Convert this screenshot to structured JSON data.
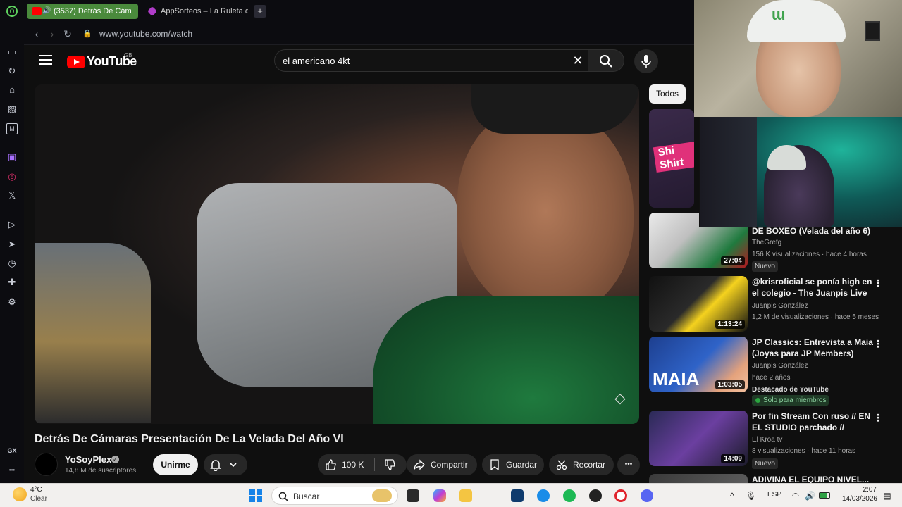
{
  "browser": {
    "tabs": [
      {
        "label": "(3537) Detrás De Cám",
        "active": true
      },
      {
        "label": "AppSorteos – La Ruleta de",
        "active": false
      }
    ],
    "new_tab_label": "+",
    "url": "www.youtube.com/watch",
    "sidebar_footer_label": "GX",
    "sidebar_more_label": "•••"
  },
  "youtube": {
    "wordmark": "YouTube",
    "country_code": "GB",
    "search_query": "el americano 4kt",
    "video_title": "Detrás De Cámaras Presentación De La Velada Del Año VI",
    "channel": {
      "name": "YoSoyPlex",
      "subscribers": "14,8 M de suscriptores"
    },
    "join_label": "Unirme",
    "actions": {
      "likes": "100 K",
      "share": "Compartir",
      "save": "Guardar",
      "clip": "Recortar",
      "more": "•••"
    },
    "chip_all": "Todos",
    "ad_badge_text": "Shi\nShirt",
    "recommendations": [
      {
        "title": "DE BOXEO (Velada del año 6) -...",
        "channel": "TheGrefg",
        "meta": "156 K visualizaciones · hace 4 horas",
        "duration": "27:04",
        "badge": "Nuevo"
      },
      {
        "title": "@krisroficial se ponía high en el colegio - The Juanpis Live Show",
        "channel": "Juanpis González",
        "meta": "1,2 M de visualizaciones · hace 5 meses",
        "duration": "1:13:24"
      },
      {
        "title": "JP Classics: Entrevista a Maia (Joyas para JP Members)",
        "channel": "Juanpis González",
        "meta": "hace 2 años",
        "duration": "1:03:05",
        "featured": "Destacado de YouTube",
        "members_badge": "Solo para miembros",
        "thumb_text": "MAIA"
      },
      {
        "title": "Por fin Stream Con ruso // EN EL STUDIO parchado // CHIMB...",
        "channel": "El Kroa tv",
        "meta": "8 visualizaciones · hace 11 horas",
        "duration": "14:09",
        "badge": "Nuevo"
      },
      {
        "title": "ADIVINA EL EQUIPO NIVEL..."
      }
    ]
  },
  "taskbar": {
    "weather_temp": "4°C",
    "weather_desc": "Clear",
    "search_label": "Buscar",
    "language": "ESP",
    "time": "2:07",
    "date": "14/03/2026"
  },
  "colors": {
    "accent_red": "#ff0000",
    "tab_active": "#4a8a3c",
    "background": "#0f0f0f"
  }
}
